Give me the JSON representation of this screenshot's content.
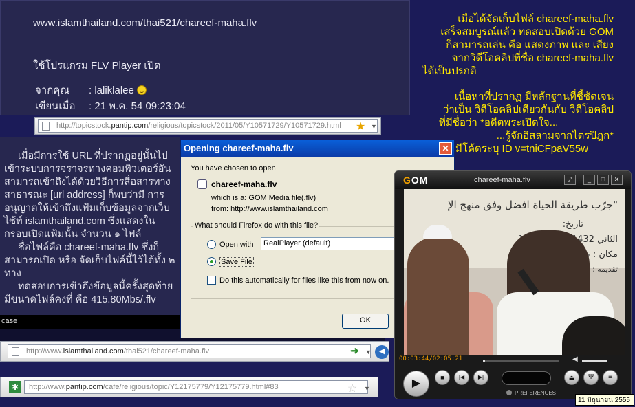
{
  "post_top": {
    "url": "www.islamthailand.com/thai521/chareef-maha.flv",
    "program_line": "ใช้โปรแกรม FLV Player เปิด",
    "from_label": "จากคุณ",
    "from_value": ": laliklalee",
    "written_label": "เขียนเมื่อ",
    "written_value": ": 21 พ.ค. 54 09:23:04"
  },
  "addressbar_1": {
    "prefix": "http://topicstock.",
    "domain": "pantip.com",
    "suffix": "/religious/topicstock/2011/05/Y10571729/Y10571729.html"
  },
  "yellow_text": {
    "p1_l1": "เมื่อได้จัดเก็บไฟล์ chareef-maha.flv",
    "p1_l2": "เสร็จสมบูรณ์แล้ว ทดสอบเปิดด้วย GOM",
    "p1_l3": "ก็สามารถเล่น คือ แสดงภาพ และ เสียง",
    "p1_l4": "จากวิดีโอคลิปที่ชื่อ chareef-maha.flv",
    "p1_l5": "ได้เป็นปรกติ",
    "p2_l1": "เนื้อหาที่ปรากฏ มีหลักฐานที่ชี้ชัดเจน",
    "p2_l2": "ว่าเป็น วิดีโอคลิปเดียวกันกับ วิดีโอคลิป",
    "p2_l3": "ที่มีชื่อว่า *อดีตพระเปิดใจ...",
    "p2_l4": "...รู้จักอิสลามจากไตรปิฎก*",
    "p2_l5": "มีโค้ดระบุ ID v=tniCFpaV55w"
  },
  "post_left": {
    "p1": "เมื่อมีการใช้ URL ที่ปรากฏอยู่นั้นไป เข้าระบบการจราจรทางคอมพิวเตอร์อันสามารถเข้าถึงได้ด้วยวิธีการสื่อสารทางสาธารณะ [url address] ก็พบว่ามี การอนุญาตให้เข้าถึงแฟ้มเก็บข้อมูลจากเว็บไซ้ท์ islamthailand.com ซึ่งแสดงในกรอบเปิดแฟ้มนั้น จำนวน ๑ ไฟล์",
    "p2": "ชื่อไฟล์คือ chareef-maha.flv ซึ่งก็สามารถเปิด หรือ จัดเก็บไฟล์นี้ไว้ได้ทั้ง ๒ ทาง",
    "p3": "ทดสอบการเข้าถึงข้อมูลนี้ครั้งสุดท้าย มีขนาดไฟล์คงที่ คือ 415.80Mbs/.flv",
    "case_label": "case"
  },
  "dialog": {
    "title": "Opening chareef-maha.flv",
    "intro": "You have chosen to open",
    "filename": "chareef-maha.flv",
    "which_is": "which is a:  GOM Media file(.flv)",
    "from": "from:  http://www.islamthailand.com",
    "question": "What should Firefox do with this file?",
    "open_with_label": "Open with",
    "open_with_app": "RealPlayer (default)",
    "save_file_label": "Save File",
    "auto_label": "Do this automatically for files like this from now on.",
    "ok_label": "OK",
    "selected": "save_file"
  },
  "addressbar_2": {
    "prefix": "http://www.",
    "domain": "islamthailand.com",
    "suffix": "/thai521/chareef-maha.flv"
  },
  "addressbar_3": {
    "prefix": "http://www.",
    "domain": "pantip.com",
    "suffix": "/cafe/religious/topic/Y12175779/Y12175779.html#83"
  },
  "gom": {
    "logo_g": "G",
    "logo_rest": "OM",
    "title": "chareef-maha.flv",
    "time": "00:03:44/02:05:21",
    "progress": 0.03,
    "volume": 0.8,
    "preferences": "PREFERENCES",
    "video_text": {
      "banner": "\"جرّب طريقة الحياة  افضل وفق منهج الإ",
      "date_label": "تاريخ:",
      "date_value": "الثاني 1432هـ الموافق 12",
      "place": "مكان : سافانسونج",
      "intro": "تقديمه : الإسلام ومبعوثان"
    }
  },
  "date_tooltip": "11 มิถุนายน 2555",
  "colors": {
    "yellow_text": "#ffe800",
    "page_bg": "#1b1b58",
    "gom_time": "#f09a00"
  }
}
